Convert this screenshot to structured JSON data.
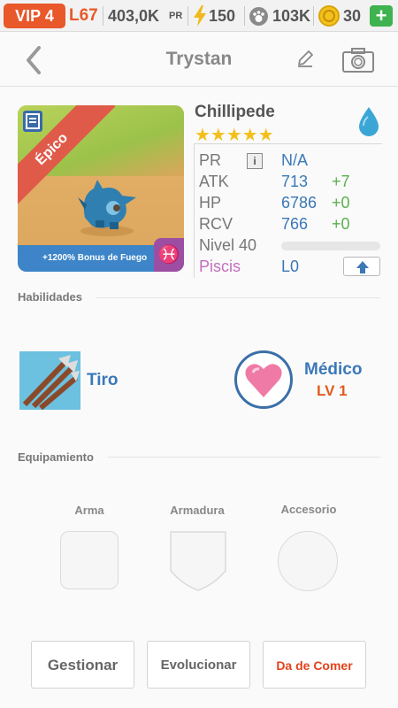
{
  "status_bar": {
    "vip": "VIP 4",
    "level": "L67",
    "power": "403,0K",
    "power_unit": "PR",
    "energy": "150",
    "paw_currency": "103K",
    "coins": "30",
    "add_label": "+",
    "icons": [
      "bolt-icon",
      "paw-icon",
      "coin-icon",
      "plus-icon"
    ]
  },
  "header": {
    "title": "Trystan",
    "icons": [
      "back-chevron-icon",
      "edit-pencil-icon",
      "camera-icon"
    ]
  },
  "monster": {
    "name": "Chillipede",
    "stars": "★★★★★",
    "rarity": "Épico",
    "bonus_banner": "+1200% Bonus de Fuego",
    "zodiac_symbol": "♓",
    "element": "water-drop-icon",
    "stats": [
      {
        "label": "PR",
        "value": "N/A",
        "bonus": ""
      },
      {
        "label": "ATK",
        "value": "713",
        "bonus": "+7"
      },
      {
        "label": "HP",
        "value": "6786",
        "bonus": "+0"
      },
      {
        "label": "RCV",
        "value": "766",
        "bonus": "+0"
      }
    ],
    "info_badge": "i",
    "level_label": "Nivel 40",
    "exp_progress": 0,
    "sign": "Piscis",
    "sign_level": "L0"
  },
  "skills": {
    "title": "Habilidades",
    "items": [
      {
        "name": "Tiro",
        "level": ""
      },
      {
        "name": "Médico",
        "level": "LV 1"
      }
    ]
  },
  "equipment": {
    "title": "Equipamiento",
    "slots": [
      "Arma",
      "Armadura",
      "Accesorio"
    ]
  },
  "actions": {
    "manage": "Gestionar",
    "evolve": "Evolucionar",
    "feed": "Da de Comer"
  },
  "colors": {
    "accent_orange": "#e8582b",
    "stat_blue": "#3b78b8",
    "bonus_green": "#5bb04e",
    "sign_purple": "#c46fbd",
    "star_gold": "#f3c01b"
  }
}
